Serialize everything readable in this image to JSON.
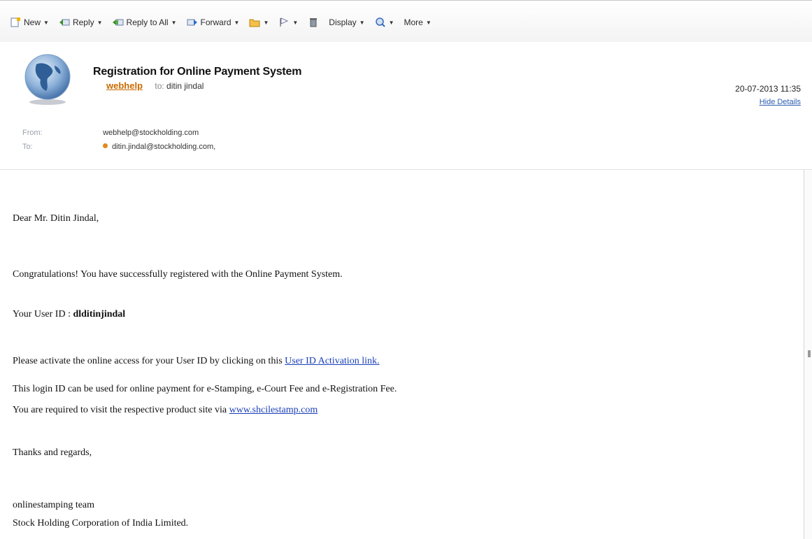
{
  "toolbar": {
    "new": "New",
    "reply": "Reply",
    "reply_all": "Reply to All",
    "forward": "Forward",
    "display": "Display",
    "more": "More"
  },
  "email": {
    "subject": "Registration for Online Payment System",
    "sender_name": "webhelp",
    "to_label": "to:",
    "to_name": "ditin jindal",
    "date": "20-07-2013 11:35",
    "hide_details": "Hide Details",
    "from_label": "From:",
    "from_value": "webhelp@stockholding.com",
    "to_field_label": "To:",
    "to_field_value": "ditin.jindal@stockholding.com,"
  },
  "body": {
    "greeting": "Dear Mr. Ditin Jindal,",
    "congrats": "Congratulations! You have successfully registered with the Online Payment System.",
    "userid_label": "Your User ID : ",
    "userid_value": "dlditinjindal",
    "activate_text": "Please activate the online access for your User ID by clicking on this ",
    "activate_link": "User ID Activation link.",
    "login_line": "This login ID can be used for online payment for e-Stamping, e-Court Fee and e-Registration Fee.",
    "visit_text": "You are required to visit the respective product site via ",
    "visit_link": "www.shcilestamp.com",
    "thanks": "Thanks and regards,",
    "team": "onlinestamping team",
    "company": "Stock Holding Corporation of India Limited."
  },
  "colors": {
    "sender": "#c86a00",
    "link": "#1a3fb8",
    "hide_details": "#2a5db0",
    "recipient_dot": "#e08a1e"
  },
  "icons": [
    "new-icon",
    "reply-icon",
    "reply-all-icon",
    "forward-icon",
    "folder-icon",
    "flag-icon",
    "trash-icon",
    "search-icon",
    "globe-avatar-icon"
  ]
}
